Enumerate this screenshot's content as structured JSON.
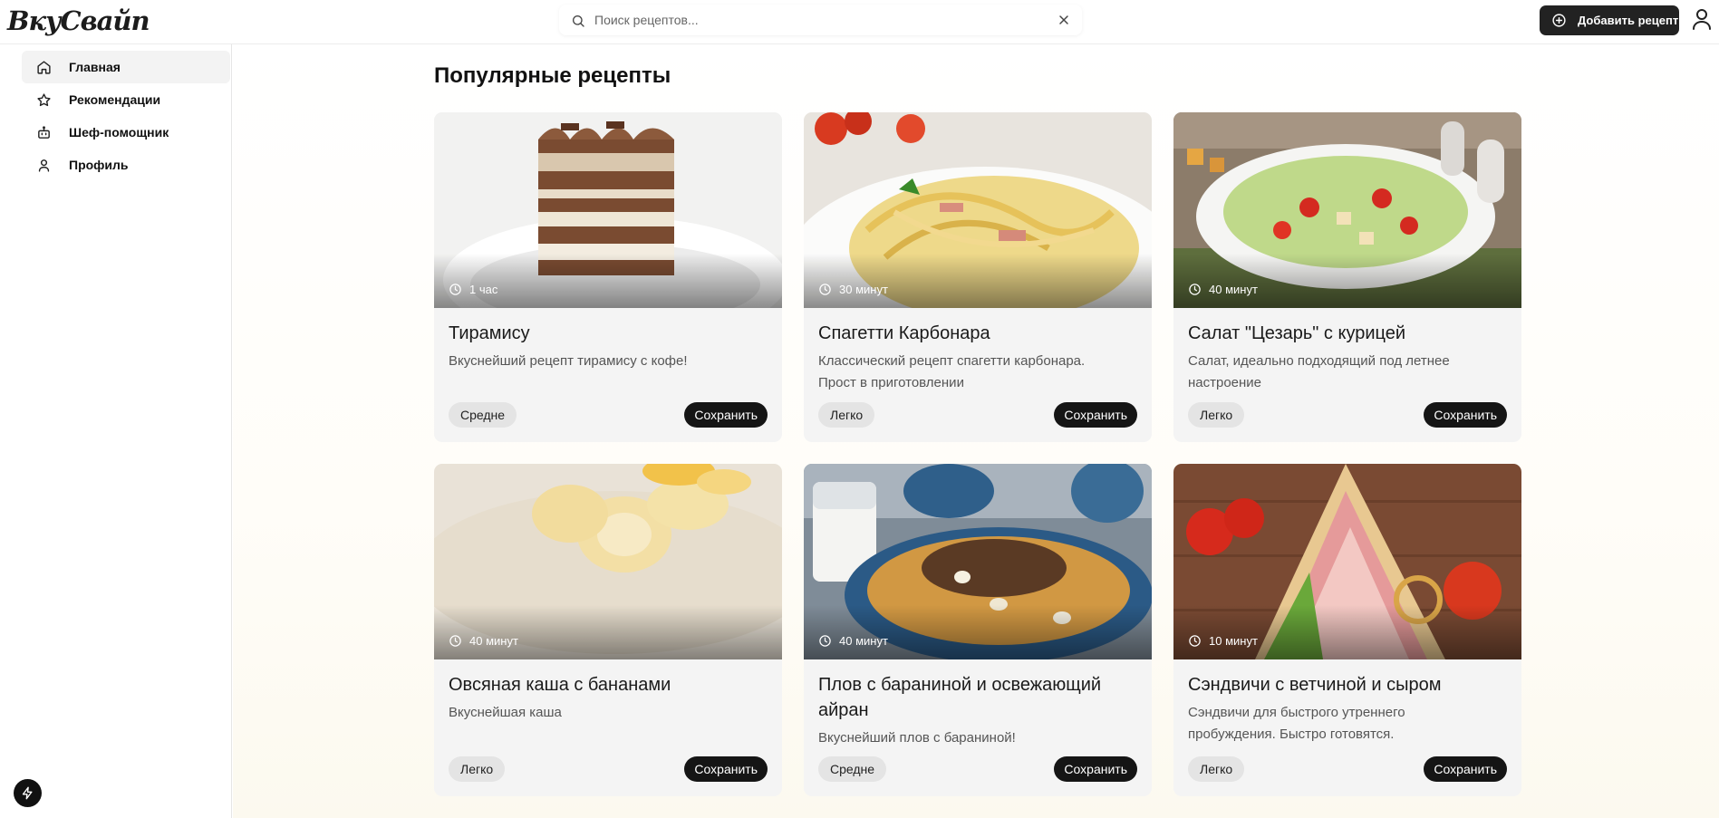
{
  "app": {
    "logo": "ВкуСвайп"
  },
  "search": {
    "placeholder": "Поиск рецептов..."
  },
  "header": {
    "add_label": "Добавить рецепт"
  },
  "sidebar": {
    "items": [
      {
        "label": "Главная",
        "icon": "home-icon"
      },
      {
        "label": "Рекомендации",
        "icon": "star-icon"
      },
      {
        "label": "Шеф-помощник",
        "icon": "bot-icon"
      },
      {
        "label": "Профиль",
        "icon": "user-icon"
      }
    ]
  },
  "main": {
    "title": "Популярные рецепты",
    "save_label": "Сохранить",
    "recipes": [
      {
        "title": "Тирамису",
        "desc": "Вкуснейший рецепт тирамису с кофе!",
        "time": "1 час",
        "difficulty": "Средне"
      },
      {
        "title": "Спагетти Карбонара",
        "desc": "Классический рецепт спагетти карбонара. Прост в приготовлении",
        "time": "30 минут",
        "difficulty": "Легко"
      },
      {
        "title": "Салат \"Цезарь\" с курицей",
        "desc": "Салат, идеально подходящий под летнее настроение",
        "time": "40 минут",
        "difficulty": "Легко"
      },
      {
        "title": "Овсяная каша с бананами",
        "desc": "Вкуснейшая каша",
        "time": "40 минут",
        "difficulty": "Легко"
      },
      {
        "title": "Плов с бараниной и освежающий айран",
        "desc": "Вкуснейший плов с бараниной!",
        "time": "40 минут",
        "difficulty": "Средне"
      },
      {
        "title": "Сэндвичи с ветчиной и сыром",
        "desc": "Сэндвичи для быстрого утреннего пробуждения. Быстро готовятся.",
        "time": "10 минут",
        "difficulty": "Легко"
      }
    ]
  },
  "colors": {
    "accent": "#151515",
    "card_bg": "#f4f4f4",
    "badge_bg": "#e4e4e4"
  }
}
